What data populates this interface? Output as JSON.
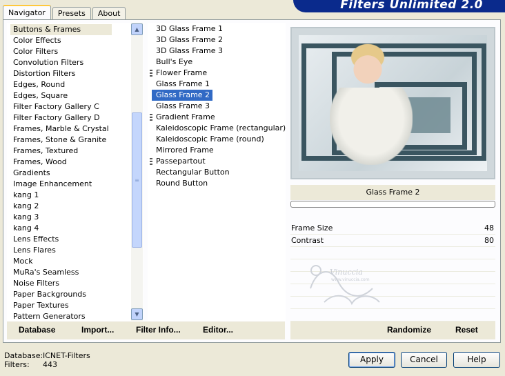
{
  "tabs": [
    "Navigator",
    "Presets",
    "About"
  ],
  "active_tab": "Navigator",
  "banner_title": "Filters Unlimited 2.0",
  "categories": [
    "Buttons & Frames",
    "Color Effects",
    "Color Filters",
    "Convolution Filters",
    "Distortion Filters",
    "Edges, Round",
    "Edges, Square",
    "Filter Factory Gallery C",
    "Filter Factory Gallery D",
    "Frames, Marble & Crystal",
    "Frames, Stone & Granite",
    "Frames, Textured",
    "Frames, Wood",
    "Gradients",
    "Image Enhancement",
    "kang 1",
    "kang 2",
    "kang 3",
    "kang 4",
    "Lens Effects",
    "Lens Flares",
    "Mock",
    "MuRa's Seamless",
    "Noise Filters",
    "Paper Backgrounds",
    "Paper Textures",
    "Pattern Generators"
  ],
  "selected_category": "Buttons & Frames",
  "filters": [
    {
      "label": "3D Glass Frame 1",
      "group": false
    },
    {
      "label": "3D Glass Frame 2",
      "group": false
    },
    {
      "label": "3D Glass Frame 3",
      "group": false
    },
    {
      "label": "Bull's Eye",
      "group": false
    },
    {
      "label": "Flower Frame",
      "group": true
    },
    {
      "label": "Glass Frame 1",
      "group": false
    },
    {
      "label": "Glass Frame 2",
      "group": false
    },
    {
      "label": "Glass Frame 3",
      "group": false
    },
    {
      "label": "Gradient Frame",
      "group": true
    },
    {
      "label": "Kaleidoscopic Frame (rectangular)",
      "group": false
    },
    {
      "label": "Kaleidoscopic Frame (round)",
      "group": false
    },
    {
      "label": "Mirrored Frame",
      "group": false
    },
    {
      "label": "Passepartout",
      "group": true
    },
    {
      "label": "Rectangular Button",
      "group": false
    },
    {
      "label": "Round Button",
      "group": false
    }
  ],
  "selected_filter": "Glass Frame 2",
  "filter_title": "Glass Frame 2",
  "params": [
    {
      "label": "Frame Size",
      "value": "48"
    },
    {
      "label": "Contrast",
      "value": "80"
    }
  ],
  "watermark": {
    "text": "Vinuccia",
    "sub": "www.vinuccia.com"
  },
  "commands": {
    "database": "Database",
    "import": "Import...",
    "filter_info": "Filter Info...",
    "editor": "Editor...",
    "randomize": "Randomize",
    "reset": "Reset"
  },
  "status": {
    "database_label": "Database:",
    "database_value": "ICNET-Filters",
    "filters_label": "Filters:",
    "filters_value": "443"
  },
  "buttons": {
    "apply": "Apply",
    "cancel": "Cancel",
    "help": "Help"
  },
  "colors": {
    "selection": "#316ac5",
    "banner": "#0a2a8c",
    "tab_accent": "#ffc83c"
  }
}
